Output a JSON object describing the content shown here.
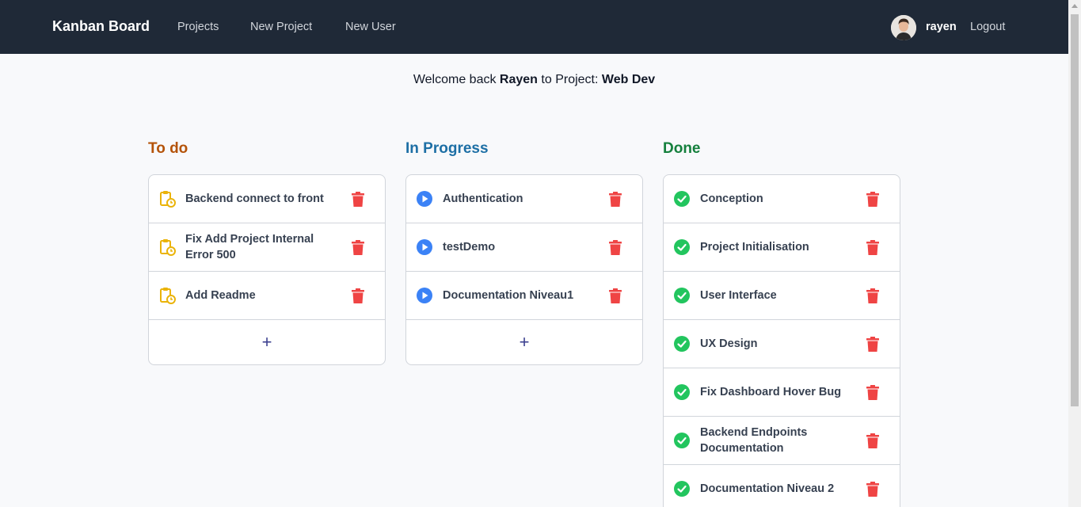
{
  "nav": {
    "brand": "Kanban Board",
    "links": [
      "Projects",
      "New Project",
      "New User"
    ],
    "username": "rayen",
    "logout": "Logout"
  },
  "welcome": {
    "prefix": "Welcome back",
    "user": "Rayen",
    "middle": "to Project:",
    "project": "Web Dev"
  },
  "columns": {
    "todo": {
      "title": "To do",
      "color": "#b45309",
      "icon": "clipboard-clock-icon",
      "tasks": [
        "Backend connect to front",
        "Fix Add Project Internal Error 500",
        "Add Readme"
      ],
      "add_label": "+"
    },
    "progress": {
      "title": "In Progress",
      "color": "#1d6fa5",
      "icon": "play-circle-icon",
      "tasks": [
        "Authentication",
        "testDemo",
        "Documentation Niveau1"
      ],
      "add_label": "+"
    },
    "done": {
      "title": "Done",
      "color": "#15803d",
      "icon": "check-circle-icon",
      "tasks": [
        "Conception",
        "Project Initialisation",
        "User Interface",
        "UX Design",
        "Fix Dashboard Hover Bug",
        "Backend Endpoints Documentation",
        "Documentation Niveau 2"
      ]
    }
  },
  "colors": {
    "navbar": "#1f2937",
    "trash": "#ef4444",
    "todo_icon": "#eab308",
    "progress_icon": "#3b82f6",
    "done_icon": "#22c55e"
  }
}
